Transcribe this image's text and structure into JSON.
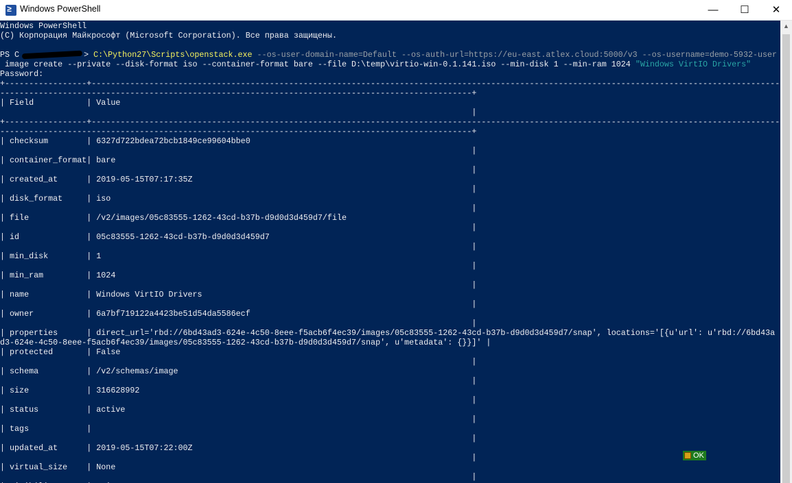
{
  "window": {
    "title": "Windows PowerShell",
    "minimize_glyph": "—",
    "maximize_glyph": "☐",
    "close_glyph": "✕",
    "app_icon_glyph": "≥"
  },
  "console": {
    "header1": "Windows PowerShell",
    "header2": "(C) Корпорация Майкрософт (Microsoft Corporation). Все права защищены.",
    "prompt_prefix": "PS C",
    "prompt_suffix": ">",
    "exe": "C:\\Python27\\Scripts\\openstack.exe",
    "cmd_args": " --os-user-domain-name=Default --os-auth-url=https://eu-east.atlex.cloud:5000/v3 --os-username=demo-5932-user",
    "cmd_line2": " image create --private --disk-format iso --container-format bare --file D:\\temp\\virtio-win-0.1.141.iso --min-disk 1 --min-ram 1024 ",
    "image_name_arg": "\"Windows VirtIO Drivers\"",
    "password_prompt": "Password:",
    "border_a": "+-----------------+-----------------------------------------------------------------------------------------------------------------------------------------------",
    "border_b": "--------------------------------------------------------------------------------------------------+",
    "header_row": "| Field           | Value",
    "row_tail": "                                                                                                  |",
    "rows": [
      {
        "field": "checksum",
        "value": "6327d722bdea72bcb1849ce99604bbe0"
      },
      {
        "field": "container_format",
        "value": "bare"
      },
      {
        "field": "created_at",
        "value": "2019-05-15T07:17:35Z"
      },
      {
        "field": "disk_format",
        "value": "iso"
      },
      {
        "field": "file",
        "value": "/v2/images/05c83555-1262-43cd-b37b-d9d0d3d459d7/file"
      },
      {
        "field": "id",
        "value": "05c83555-1262-43cd-b37b-d9d0d3d459d7"
      },
      {
        "field": "min_disk",
        "value": "1"
      },
      {
        "field": "min_ram",
        "value": "1024"
      },
      {
        "field": "name",
        "value": "Windows VirtIO Drivers"
      },
      {
        "field": "owner",
        "value": "6a7bf719122a4423be51d54da5586ecf"
      }
    ],
    "properties_line1": "| properties      | direct_url='rbd://6bd43ad3-624e-4c50-8eee-f5acb6f4ec39/images/05c83555-1262-43cd-b37b-d9d0d3d459d7/snap', locations='[{u'url': u'rbd://6bd43a",
    "properties_line2": "d3-624e-4c50-8eee-f5acb6f4ec39/images/05c83555-1262-43cd-b37b-d9d0d3d459d7/snap', u'metadata': {}}]' |",
    "rows2": [
      {
        "field": "protected",
        "value": "False"
      },
      {
        "field": "schema",
        "value": "/v2/schemas/image"
      },
      {
        "field": "size",
        "value": "316628992"
      },
      {
        "field": "status",
        "value": "active"
      },
      {
        "field": "tags",
        "value": ""
      },
      {
        "field": "updated_at",
        "value": "2019-05-15T07:22:00Z"
      },
      {
        "field": "virtual_size",
        "value": "None"
      }
    ],
    "partial_last_row": "| visibility      | private"
  },
  "notification": {
    "label": "OK"
  },
  "colors": {
    "console_bg": "#012456",
    "console_text": "#eeedf0",
    "path_yellow": "#f6f25e",
    "string_teal": "#2aa6a6"
  }
}
